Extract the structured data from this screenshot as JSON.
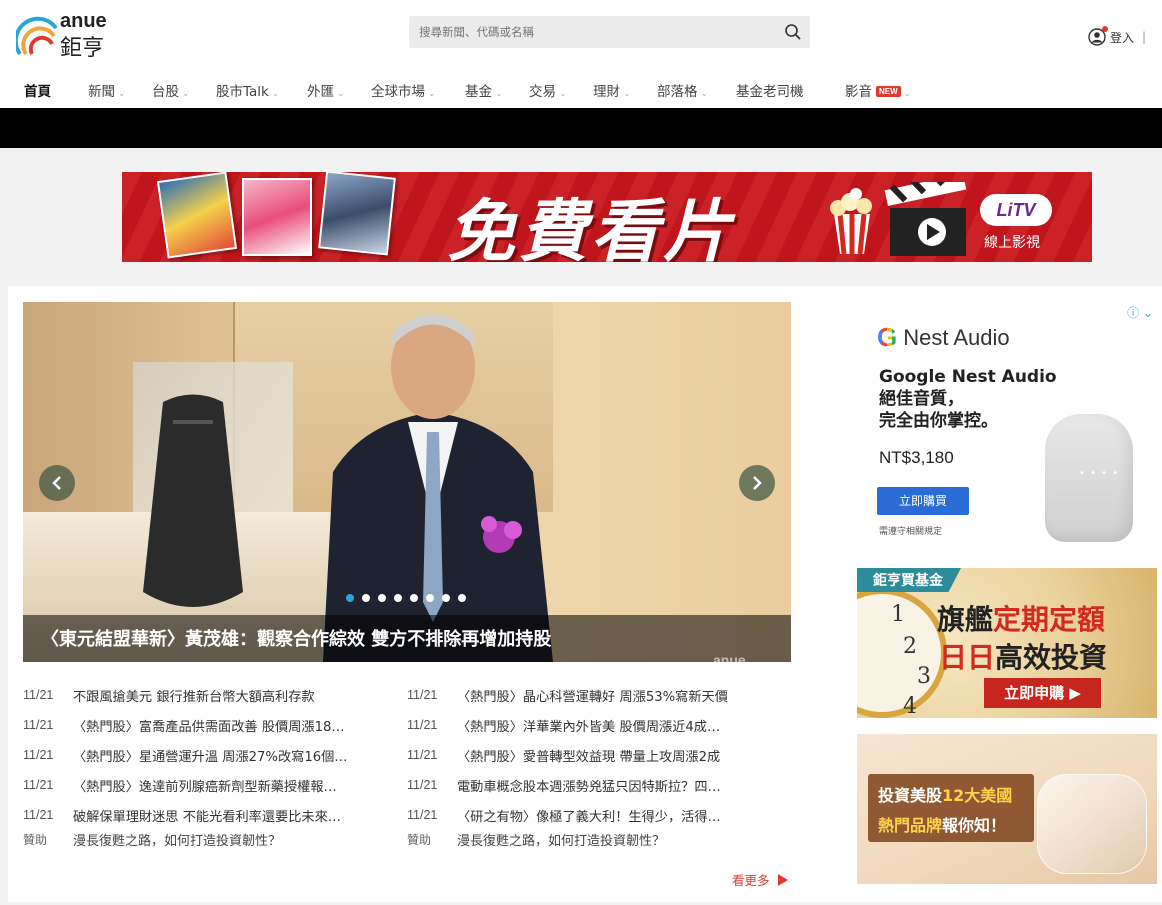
{
  "header": {
    "logo_en": "anue",
    "logo_zh": "鉅亨",
    "search_placeholder": "搜尋新聞、代碼或名稱",
    "login_label": "登入",
    "login_sep": "|"
  },
  "nav": {
    "items": [
      {
        "label": "首頁"
      },
      {
        "label": "新聞"
      },
      {
        "label": "台股"
      },
      {
        "label": "股市Talk"
      },
      {
        "label": "外匯"
      },
      {
        "label": "全球市場"
      },
      {
        "label": "基金"
      },
      {
        "label": "交易"
      },
      {
        "label": "理財"
      },
      {
        "label": "部落格"
      },
      {
        "label": "基金老司機"
      },
      {
        "label": "影音"
      }
    ],
    "new_badge": "NEW"
  },
  "banner": {
    "title": "免費看片",
    "brand": "LiTV",
    "brand_sub": "線上影視",
    "accent_color": "#c8161d"
  },
  "carousel": {
    "caption": "〈東元結盟華新〉黃茂雄：觀察合作綜效 雙方不排除再增加持股",
    "watermark": "anue",
    "slide_count": 8,
    "active_slide": 1
  },
  "news": {
    "left": [
      {
        "date": "11/21",
        "title": "不跟風搶美元 銀行推新台幣大額高利存款"
      },
      {
        "date": "11/21",
        "title": "〈熱門股〉富喬產品供需面改善 股價周漲18…"
      },
      {
        "date": "11/21",
        "title": "〈熱門股〉星通營運升溫 周漲27%改寫16個…"
      },
      {
        "date": "11/21",
        "title": "〈熱門股〉逸達前列腺癌新劑型新藥授權報…"
      },
      {
        "date": "11/21",
        "title": "破解保單理財迷思 不能光看利率還要比未來…"
      }
    ],
    "right": [
      {
        "date": "11/21",
        "title": "〈熱門股〉晶心科營運轉好 周漲53%寫新天價"
      },
      {
        "date": "11/21",
        "title": "〈熱門股〉洋華業內外皆美 股價周漲近4成…"
      },
      {
        "date": "11/21",
        "title": "〈熱門股〉愛普轉型效益現 帶量上攻周漲2成"
      },
      {
        "date": "11/21",
        "title": "電動車概念股本週漲勢兇猛只因特斯拉？四…"
      },
      {
        "date": "11/21",
        "title": "〈研之有物〉像極了義大利！生得少，活得…"
      }
    ],
    "sponsor_left": {
      "tag": "贊助",
      "title": "漫長復甦之路，如何打造投資韌性？"
    },
    "sponsor_right": {
      "tag": "贊助",
      "title": "漫長復甦之路，如何打造投資韌性？"
    },
    "more_label": "看更多"
  },
  "ads": {
    "nest": {
      "brand": "Nest Audio",
      "g_letter": "G",
      "head_line1": "Google Nest Audio",
      "head_line2": "絕佳音質，",
      "head_line3": "完全由你掌控。",
      "price": "NT$3,180",
      "button": "立即購買",
      "note": "需遵守相關規定"
    },
    "fund": {
      "tag": "鉅亨買基金",
      "line1_a": "旗艦",
      "line1_b": "定期定額",
      "line2_a": "日日",
      "line2_b": "高效投資",
      "button": "立即申購 ▶"
    },
    "us": {
      "line1_a": "投資美股",
      "line1_b": "12大美國",
      "line2_a": "熱門品牌",
      "line2_b": "報你知！"
    }
  }
}
